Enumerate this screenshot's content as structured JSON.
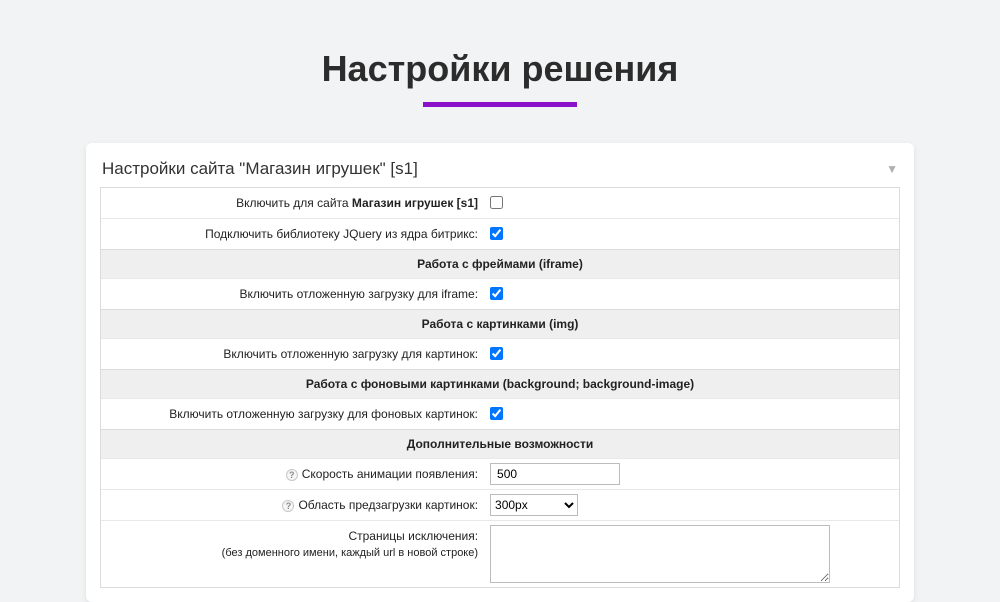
{
  "page": {
    "title": "Настройки решения"
  },
  "panel": {
    "header": "Настройки сайта \"Магазин игрушек\" [s1]"
  },
  "rows": {
    "enable_site": {
      "label_pre": "Включить для сайта ",
      "label_bold": "Магазин игрушек [s1]",
      "checked": false
    },
    "jquery_core": {
      "label": "Подключить библиотеку JQuery из ядра битрикс:",
      "checked": true
    },
    "section_iframe": "Работа с фреймами (iframe)",
    "iframe_lazy": {
      "label": "Включить отложенную загрузку для iframe:",
      "checked": true
    },
    "section_img": "Работа с картинками (img)",
    "img_lazy": {
      "label": "Включить отложенную загрузку для картинок:",
      "checked": true
    },
    "section_bg": "Работа с фоновыми картинками (background; background-image)",
    "bg_lazy": {
      "label": "Включить отложенную загрузку для фоновых картинок:",
      "checked": true
    },
    "section_extra": "Дополнительные возможности",
    "anim_speed": {
      "label": "Скорость анимации появления:",
      "value": "500"
    },
    "preload_area": {
      "label": "Область предзагрузки картинок:",
      "value": "300px"
    },
    "exclusions": {
      "label": "Страницы исключения:",
      "sublabel": "(без доменного имени, каждый url в новой строке)",
      "value": ""
    }
  },
  "help_glyph": "?"
}
